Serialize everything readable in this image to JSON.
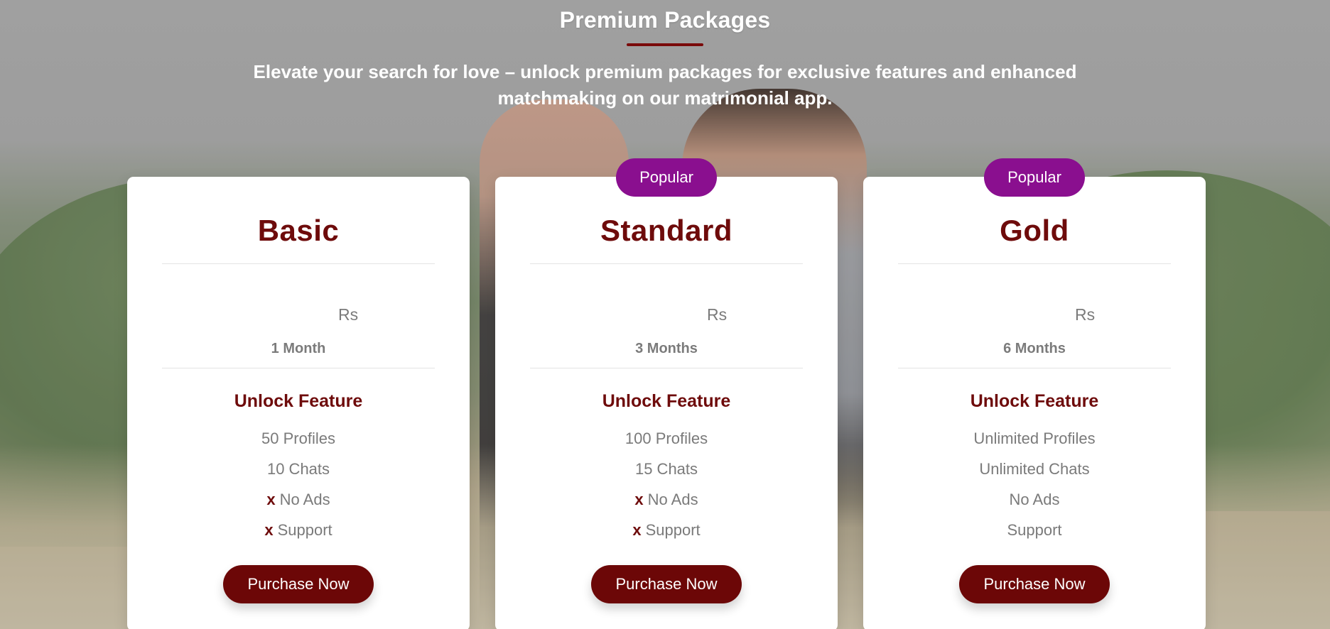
{
  "section": {
    "title": "Premium Packages",
    "subtitle": "Elevate your search for love – unlock premium packages for exclusive features and enhanced matchmaking on our matrimonial app."
  },
  "packages": [
    {
      "name": "Basic",
      "badge": "",
      "currency": "Rs",
      "price": "",
      "duration": "1 Month",
      "feature_title": "Unlock Feature",
      "features": [
        {
          "mark": "",
          "text": "50 Profiles"
        },
        {
          "mark": "",
          "text": "10 Chats"
        },
        {
          "mark": "x",
          "text": "No Ads"
        },
        {
          "mark": "x",
          "text": "Support"
        }
      ],
      "button": "Purchase Now"
    },
    {
      "name": "Standard",
      "badge": "Popular",
      "currency": "Rs",
      "price": "",
      "duration": "3 Months",
      "feature_title": "Unlock Feature",
      "features": [
        {
          "mark": "",
          "text": "100 Profiles"
        },
        {
          "mark": "",
          "text": "15 Chats"
        },
        {
          "mark": "x",
          "text": "No Ads"
        },
        {
          "mark": "x",
          "text": "Support"
        }
      ],
      "button": "Purchase Now"
    },
    {
      "name": "Gold",
      "badge": "Popular",
      "currency": "Rs",
      "price": "",
      "duration": "6 Months",
      "feature_title": "Unlock Feature",
      "features": [
        {
          "mark": "",
          "text": "Unlimited Profiles"
        },
        {
          "mark": "",
          "text": "Unlimited Chats"
        },
        {
          "mark": "",
          "text": "No Ads"
        },
        {
          "mark": "",
          "text": "Support"
        }
      ],
      "button": "Purchase Now"
    }
  ],
  "colors": {
    "brand_maroon": "#6e0b0b",
    "badge_purple": "#8a0f8f",
    "button_bg": "#6c0707",
    "muted_text": "#7b7b7b"
  }
}
